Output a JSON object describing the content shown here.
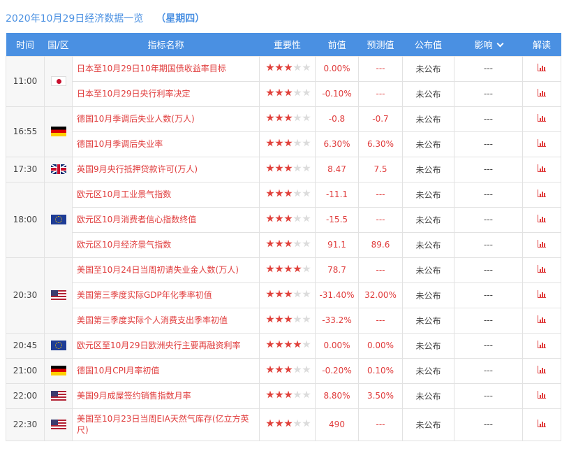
{
  "header": {
    "date_title": "2020年10月29日经济数据一览",
    "weekday": "（星期四）"
  },
  "columns": [
    "时间",
    "国/区",
    "指标名称",
    "重要性",
    "前值",
    "预测值",
    "公布值",
    "影响",
    "解读"
  ],
  "colors": {
    "accent": "#4a90e2",
    "value_red": "#e03c3c",
    "star_on": "#e0413b",
    "star_off": "#dcdcdc"
  },
  "groups": [
    {
      "time": "11:00",
      "flag": "japan-flag",
      "rows": [
        {
          "name": "日本至10月29日10年期国债收益率目标",
          "importance": 3,
          "prev": "0.00%",
          "forecast": "---",
          "actual": "未公布",
          "impact": "---"
        },
        {
          "name": "日本至10月29日央行利率决定",
          "importance": 3,
          "prev": "-0.10%",
          "forecast": "---",
          "actual": "未公布",
          "impact": "---"
        }
      ]
    },
    {
      "time": "16:55",
      "flag": "germany-flag",
      "rows": [
        {
          "name": "德国10月季调后失业人数(万人)",
          "importance": 3,
          "prev": "-0.8",
          "forecast": "-0.7",
          "actual": "未公布",
          "impact": "---"
        },
        {
          "name": "德国10月季调后失业率",
          "importance": 3,
          "prev": "6.30%",
          "forecast": "6.30%",
          "actual": "未公布",
          "impact": "---"
        }
      ]
    },
    {
      "time": "17:30",
      "flag": "uk-flag",
      "rows": [
        {
          "name": "英国9月央行抵押贷款许可(万人)",
          "importance": 3,
          "prev": "8.47",
          "forecast": "7.5",
          "actual": "未公布",
          "impact": "---"
        }
      ]
    },
    {
      "time": "18:00",
      "flag": "eu-flag",
      "rows": [
        {
          "name": "欧元区10月工业景气指数",
          "importance": 3,
          "prev": "-11.1",
          "forecast": "---",
          "actual": "未公布",
          "impact": "---"
        },
        {
          "name": "欧元区10月消费者信心指数终值",
          "importance": 3,
          "prev": "-15.5",
          "forecast": "---",
          "actual": "未公布",
          "impact": "---"
        },
        {
          "name": "欧元区10月经济景气指数",
          "importance": 3,
          "prev": "91.1",
          "forecast": "89.6",
          "actual": "未公布",
          "impact": "---"
        }
      ]
    },
    {
      "time": "20:30",
      "flag": "us-flag",
      "rows": [
        {
          "name": "美国至10月24日当周初请失业金人数(万人)",
          "importance": 4,
          "prev": "78.7",
          "forecast": "---",
          "actual": "未公布",
          "impact": "---"
        },
        {
          "name": "美国第三季度实际GDP年化季率初值",
          "importance": 3,
          "prev": "-31.40%",
          "forecast": "32.00%",
          "actual": "未公布",
          "impact": "---"
        },
        {
          "name": "美国第三季度实际个人消费支出季率初值",
          "importance": 3,
          "prev": "-33.2%",
          "forecast": "---",
          "actual": "未公布",
          "impact": "---"
        }
      ]
    },
    {
      "time": "20:45",
      "flag": "eu-flag",
      "rows": [
        {
          "name": "欧元区至10月29日欧洲央行主要再融资利率",
          "importance": 4,
          "prev": "0.00%",
          "forecast": "0.00%",
          "actual": "未公布",
          "impact": "---"
        }
      ]
    },
    {
      "time": "21:00",
      "flag": "germany-flag",
      "rows": [
        {
          "name": "德国10月CPI月率初值",
          "importance": 3,
          "prev": "-0.20%",
          "forecast": "0.10%",
          "actual": "未公布",
          "impact": "---"
        }
      ]
    },
    {
      "time": "22:00",
      "flag": "us-flag",
      "rows": [
        {
          "name": "美国9月成屋签约销售指数月率",
          "importance": 3,
          "prev": "8.80%",
          "forecast": "3.50%",
          "actual": "未公布",
          "impact": "---"
        }
      ]
    },
    {
      "time": "22:30",
      "flag": "us-flag",
      "rows": [
        {
          "name": "美国至10月23日当周EIA天然气库存(亿立方英尺)",
          "importance": 3,
          "prev": "490",
          "forecast": "---",
          "actual": "未公布",
          "impact": "---",
          "tall": true
        }
      ]
    }
  ]
}
